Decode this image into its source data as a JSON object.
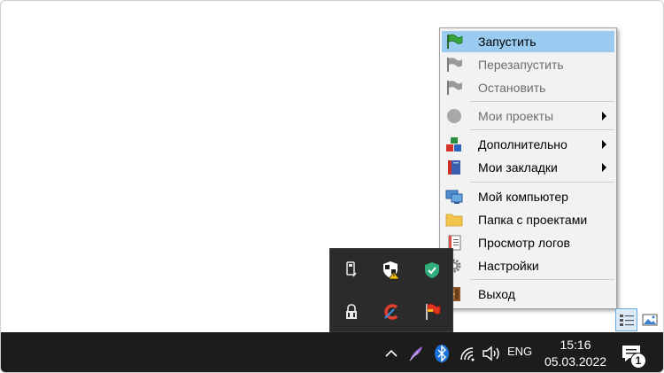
{
  "context_menu": {
    "items": [
      {
        "label": "Запустить",
        "icon": "green-flag-icon",
        "state": "highlighted"
      },
      {
        "label": "Перезапустить",
        "icon": "gray-flag-icon",
        "state": "disabled"
      },
      {
        "label": "Остановить",
        "icon": "gray-flag-icon",
        "state": "disabled"
      },
      {
        "label": "Мои проекты",
        "icon": "gray-circle-icon",
        "state": "disabled",
        "submenu": true
      },
      {
        "label": "Дополнительно",
        "icon": "blocks-icon",
        "state": "enabled",
        "submenu": true
      },
      {
        "label": "Мои закладки",
        "icon": "bookmark-book-icon",
        "state": "enabled",
        "submenu": true
      },
      {
        "label": "Мой компьютер",
        "icon": "computer-icon",
        "state": "enabled"
      },
      {
        "label": "Папка с проектами",
        "icon": "folder-icon",
        "state": "enabled"
      },
      {
        "label": "Просмотр логов",
        "icon": "log-notebook-icon",
        "state": "enabled"
      },
      {
        "label": "Настройки",
        "icon": "gear-icon",
        "state": "enabled"
      },
      {
        "label": "Выход",
        "icon": "exit-door-icon",
        "state": "enabled"
      }
    ]
  },
  "taskbar": {
    "time": "15:16",
    "date": "05.03.2022",
    "language": "ENG",
    "notification_count": "1",
    "icons": [
      "chevron-up-icon",
      "feather-icon",
      "bluetooth-icon",
      "wifi-icon",
      "speaker-icon",
      "notification-icon"
    ]
  },
  "tray_flyout": {
    "icons": [
      "usb-drive-icon",
      "security-shield-warning-icon",
      "green-shield-icon",
      "network-lock-icon",
      "ccleaner-icon",
      "red-flag-icon"
    ]
  },
  "colors": {
    "highlight": "#99ccf0",
    "taskbar": "#1c1c1c",
    "menu_bg": "#f2f2f2"
  }
}
